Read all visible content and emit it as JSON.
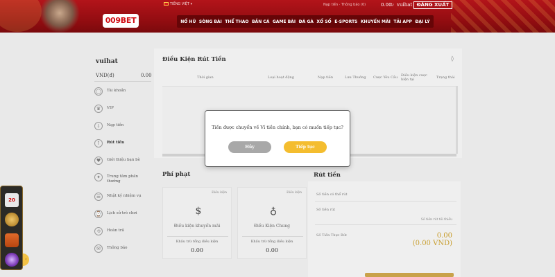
{
  "header": {
    "logo": "009BET",
    "language": "TIẾNG VIỆT",
    "top_info": "Nạp tiền · Thông báo (0)",
    "balance": "0.00",
    "username": "vuihat",
    "logout_label": "ĐĂNG XUẤT",
    "nav": [
      "NỔ HŨ",
      "SÒNG BÀI",
      "THỂ THAO",
      "BẮN CÁ",
      "GAME BÀI",
      "ĐÁ GÀ",
      "XỔ SỐ",
      "E-SPORTS",
      "KHUYẾN MÃI",
      "TẢI APP",
      "ĐẠI LÝ"
    ]
  },
  "sidebar": {
    "username": "vuihat",
    "currency": "VND(đ)",
    "amount": "0.00",
    "items": [
      {
        "label": "Tài khoản",
        "icon": "user-icon"
      },
      {
        "label": "VIP",
        "icon": "vip-icon"
      },
      {
        "label": "Nạp tiền",
        "icon": "deposit-icon"
      },
      {
        "label": "Rút tiền",
        "icon": "withdraw-icon"
      },
      {
        "label": "Giới thiệu bạn bè",
        "icon": "referral-icon"
      },
      {
        "label": "Trung tâm phần thưởng",
        "icon": "reward-icon"
      },
      {
        "label": "Nhật ký nhiệm vụ",
        "icon": "task-log-icon"
      },
      {
        "label": "Lịch sử trò chơi",
        "icon": "game-history-icon"
      },
      {
        "label": "Hoàn trả",
        "icon": "rebate-icon"
      },
      {
        "label": "Thông báo",
        "icon": "notification-icon"
      }
    ]
  },
  "main": {
    "title": "Điều Kiện Rút Tiền",
    "columns": [
      "Thời gian",
      "Loại hoạt động",
      "Nạp tiền",
      "Lưu Thưởng",
      "Cược Yêu Cầu",
      "Điều kiện cược hiện tại",
      "Trạng thái"
    ]
  },
  "penalty": {
    "title": "Phí phạt",
    "cards": [
      {
        "tag": "Điều kiện",
        "name": "Điều kiện khuyến mãi",
        "sub": "Khấu trừ tổng điều kiện",
        "value": "0.00",
        "icon": "coins-icon"
      },
      {
        "tag": "Điều kiện",
        "name": "Điều Kiện Chung",
        "sub": "Khấu trừ tổng điều kiện",
        "value": "0.00",
        "icon": "moneybag-icon"
      }
    ]
  },
  "withdraw": {
    "title": "Rút tiền",
    "row1": "Số tiền có thể rút",
    "row2": "Số tiền rút",
    "note": "Số tiền rút tối thiểu",
    "total_label": "Số Tiền Thực Rút",
    "value1": "0.00",
    "value2": "(0.00 VND)"
  },
  "modal": {
    "message": "Tiền được chuyển về Ví tiền chính, bạn có muốn tiếp tục?",
    "cancel_label": "Hủy",
    "continue_label": "Tiếp tục"
  },
  "widgets": {
    "calendar_label": "20"
  },
  "colors": {
    "header_red": "#b3141a",
    "accent_gold": "#f4bd2f",
    "cancel_gray": "#a8a8a8"
  }
}
